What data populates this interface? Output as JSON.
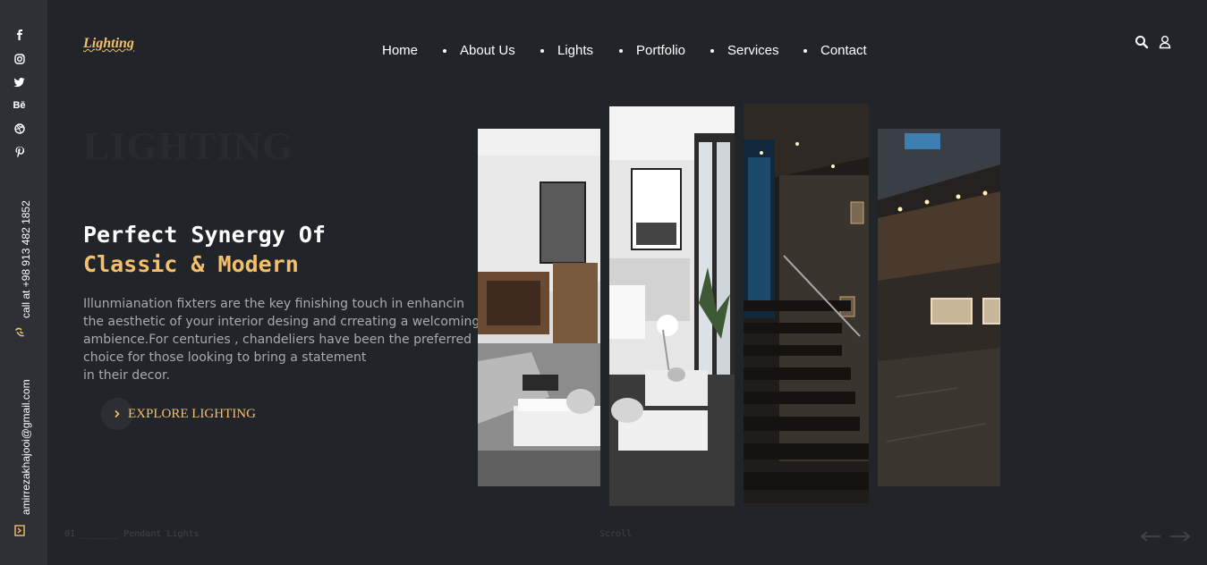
{
  "brand": {
    "logo": "Lighting"
  },
  "social": {
    "icons": [
      "facebook-icon",
      "instagram-icon",
      "twitter-icon",
      "behance-icon",
      "dribbble-icon",
      "pinterest-icon"
    ],
    "behance_text": "Bē"
  },
  "contact": {
    "phone_label": "call at +98 913 482 1852",
    "email": "amirrezakhajooi@gmail.com"
  },
  "nav": {
    "items": [
      "Home",
      "About Us",
      "Lights",
      "Portfolio",
      "Services",
      "Contact"
    ]
  },
  "header_icons": [
    "search-icon",
    "user-icon"
  ],
  "hero": {
    "ghost_title": "LIGHTING",
    "headline_line1": "Perfect Synergy Of",
    "headline_line2": "Classic & Modern",
    "description_lines": [
      "Illunmianation fixters are the key finishing touch in enhancin",
      "the aesthetic of your interior desing and crreating a welcoming",
      "ambience.For centuries , chandeliers have been the preferred",
      "choice for those looking to bring a statement",
      "in their decor."
    ],
    "cta_label": "EXPLORE LIGHTING"
  },
  "footer": {
    "slide_label": "01 _______ Pendant Lights",
    "scroll_label": "Scroll"
  },
  "colors": {
    "background": "#212429",
    "sidebar": "#2d3035",
    "accent": "#f5c06a",
    "muted_text": "#a7aab0"
  }
}
